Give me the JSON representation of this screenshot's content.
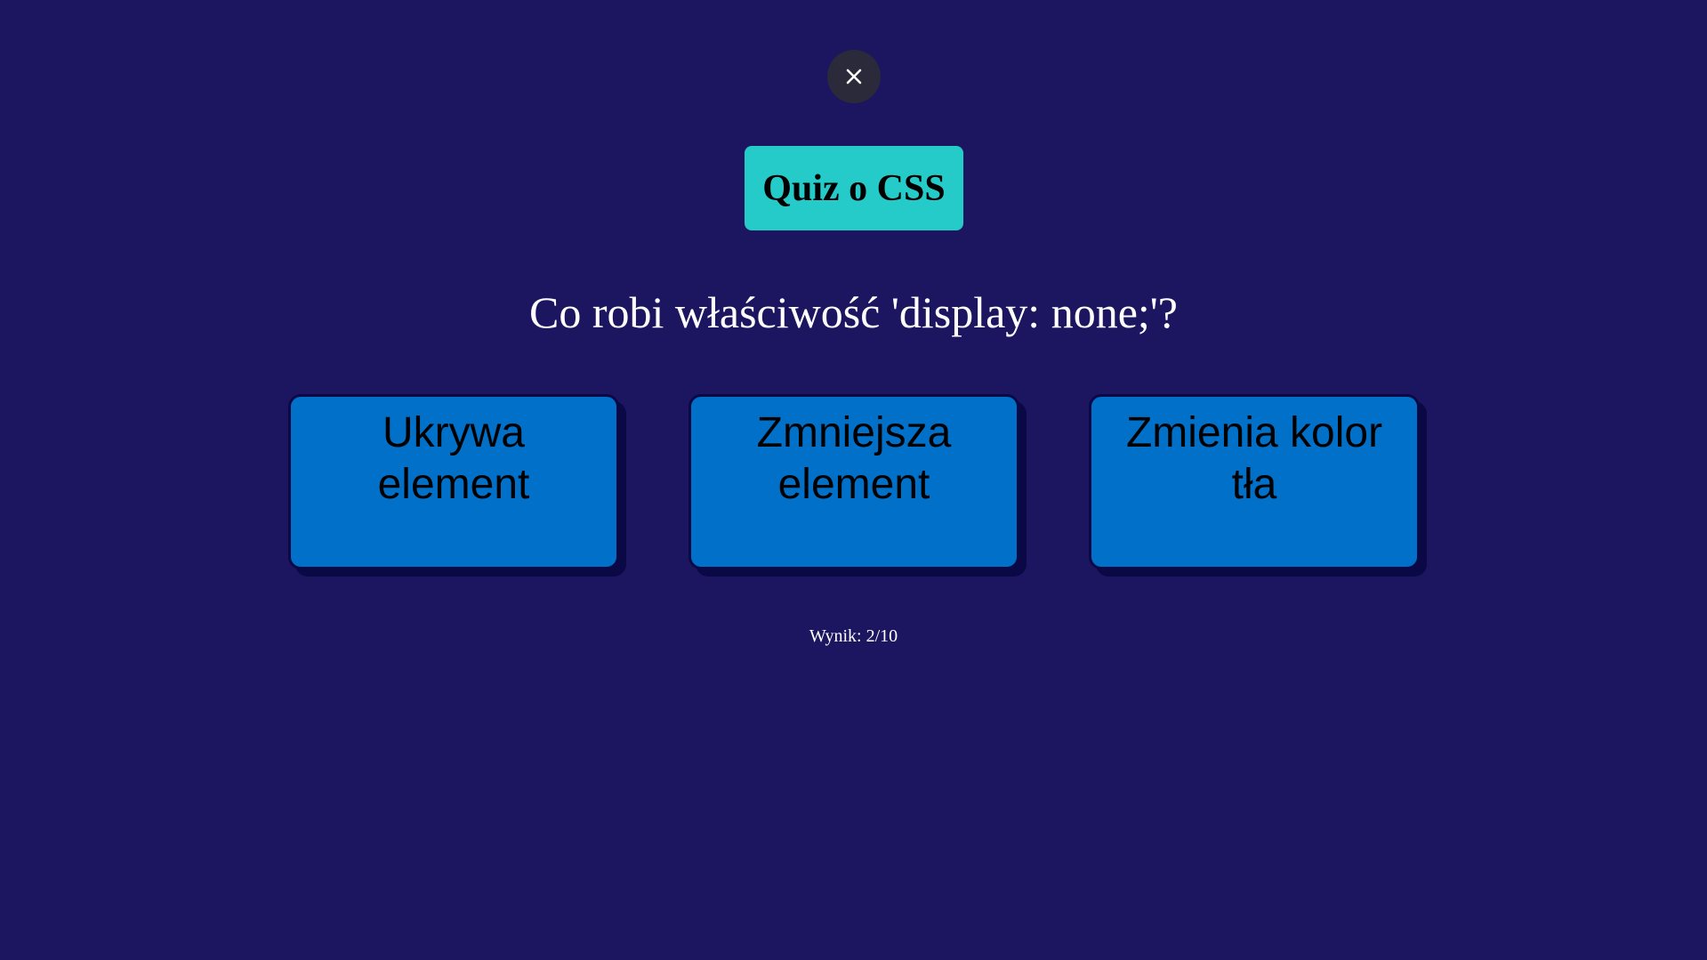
{
  "header": {
    "close_icon": "close-icon",
    "title": "Quiz o CSS"
  },
  "question": {
    "text": "Co robi właściwość 'display: none;'?"
  },
  "answers": [
    {
      "label": "Ukrywa element"
    },
    {
      "label": "Zmniejsza element"
    },
    {
      "label": "Zmienia kolor tła"
    }
  ],
  "score": {
    "text": "Wynik: 2/10"
  },
  "colors": {
    "background": "#1c1660",
    "title_bg": "#25cbc9",
    "answer_bg": "#0070c9",
    "answer_border": "#0a0845",
    "close_bg": "#2a2a3a"
  }
}
